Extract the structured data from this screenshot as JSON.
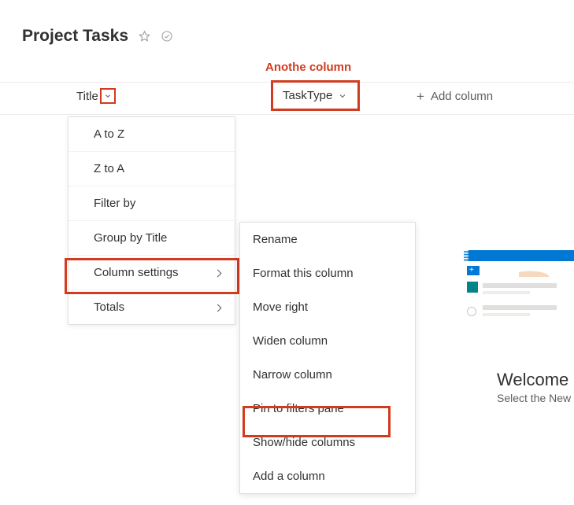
{
  "header": {
    "title": "Project Tasks"
  },
  "annotation": "Anothe column",
  "columns": {
    "title_label": "Title",
    "tasktype_label": "TaskType",
    "add_label": "Add column"
  },
  "menu1": {
    "a_to_z": "A to Z",
    "z_to_a": "Z to A",
    "filter_by": "Filter by",
    "group_by": "Group by Title",
    "column_settings": "Column settings",
    "totals": "Totals"
  },
  "menu2": {
    "rename": "Rename",
    "format": "Format this column",
    "move_right": "Move right",
    "widen": "Widen column",
    "narrow": "Narrow column",
    "pin": "Pin to filters pane",
    "show_hide": "Show/hide columns",
    "add": "Add a column"
  },
  "welcome": {
    "title": "Welcome",
    "sub": "Select the New"
  },
  "colors": {
    "highlight": "#d13b1f",
    "brand": "#0078d4"
  }
}
